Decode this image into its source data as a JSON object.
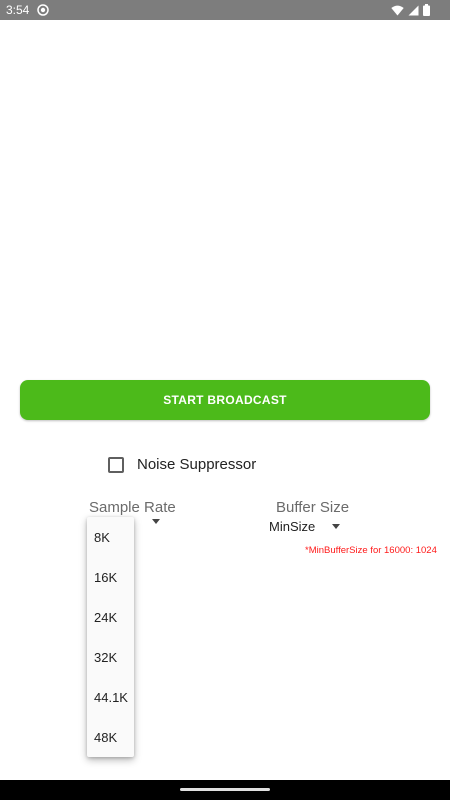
{
  "status_bar": {
    "time": "3:54",
    "icons": [
      "app-notification-icon",
      "wifi-icon",
      "signal-icon",
      "battery-icon"
    ]
  },
  "main": {
    "start_button_label": "START BROADCAST",
    "noise_suppressor_label": "Noise Suppressor",
    "noise_suppressor_checked": false,
    "sample_rate_label": "Sample Rate",
    "buffer_size_label": "Buffer Size",
    "buffer_size_value": "MinSize",
    "min_buffer_note": "*MinBufferSize for 16000: 1024"
  },
  "dropdown": {
    "options": [
      "8K",
      "16K",
      "24K",
      "32K",
      "44.1K",
      "48K"
    ]
  },
  "colors": {
    "accent": "#4cba1a",
    "note": "#ff1a1a",
    "status_bar": "#7d7d7d"
  }
}
